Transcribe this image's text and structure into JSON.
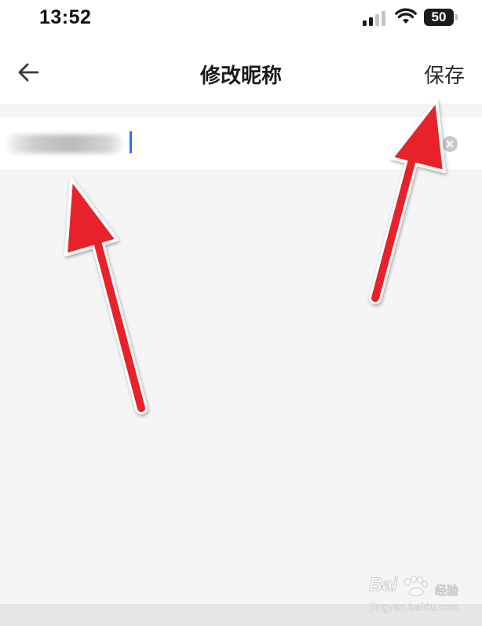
{
  "status_bar": {
    "time": "13:52",
    "signal_icon": "cellular-signal-icon",
    "wifi_icon": "wifi-icon",
    "battery_icon": "battery-icon",
    "battery_level": "50"
  },
  "nav": {
    "back_icon": "arrow-left-icon",
    "title": "修改昵称",
    "save_label": "保存"
  },
  "input": {
    "value": "",
    "clear_icon": "clear-circle-icon"
  },
  "annotations": {
    "arrow_color": "#e8242a"
  },
  "watermark": {
    "brand": "Bai",
    "sub": "经验",
    "site": "jingyan.baidu.com"
  },
  "colors": {
    "background": "#f5f5f6",
    "surface": "#ffffff",
    "cursor": "#2f6ff5"
  }
}
